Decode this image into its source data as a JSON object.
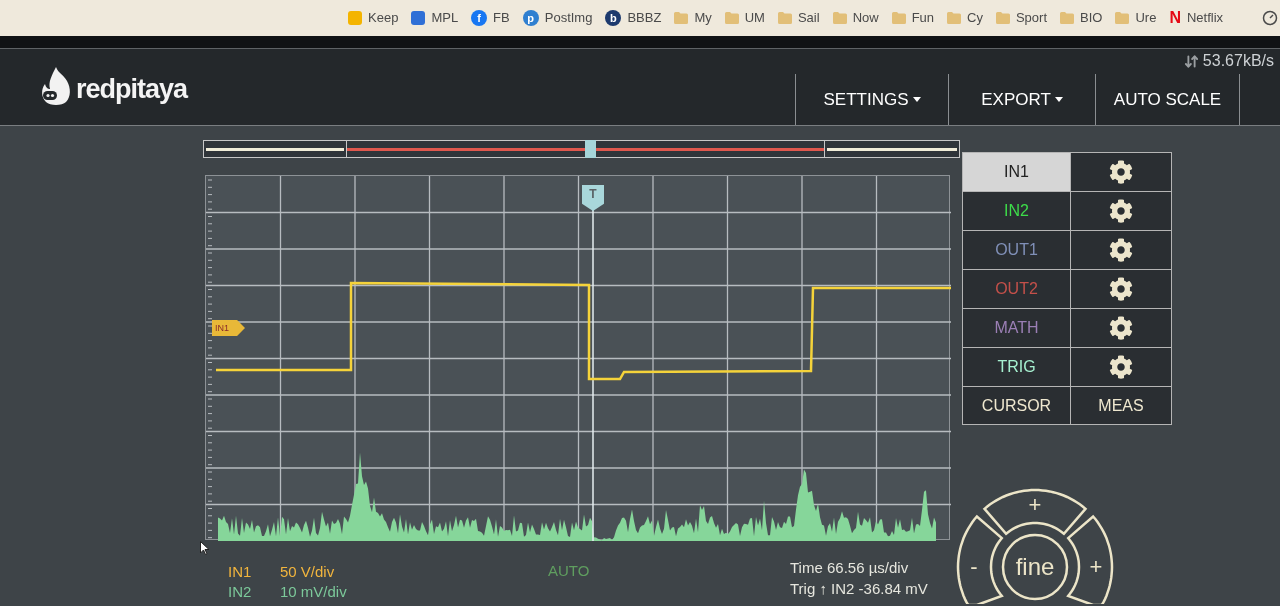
{
  "bookmarks": [
    {
      "label": "Keep",
      "kind": "tile",
      "color": "#f4b400"
    },
    {
      "label": "MPL",
      "kind": "tile",
      "color": "#2f6fd6"
    },
    {
      "label": "FB",
      "kind": "badge",
      "glyph": "f",
      "color": "#1877f2"
    },
    {
      "label": "PostImg",
      "kind": "badge",
      "glyph": "p",
      "color": "#2f7fd0"
    },
    {
      "label": "BBBZ",
      "kind": "badge",
      "glyph": "b",
      "color": "#1d3a6e"
    },
    {
      "label": "My",
      "kind": "folder"
    },
    {
      "label": "UM",
      "kind": "folder"
    },
    {
      "label": "Sail",
      "kind": "folder"
    },
    {
      "label": "Now",
      "kind": "folder"
    },
    {
      "label": "Fun",
      "kind": "folder"
    },
    {
      "label": "Cy",
      "kind": "folder"
    },
    {
      "label": "Sport",
      "kind": "folder"
    },
    {
      "label": "BIO",
      "kind": "folder"
    },
    {
      "label": "Ure",
      "kind": "folder"
    },
    {
      "label": "Netflix",
      "kind": "letter",
      "glyph": "N",
      "color": "#e50914"
    }
  ],
  "header": {
    "logo": "redpitaya",
    "speed": "53.67kB/s",
    "menu": [
      {
        "label": "SETTINGS",
        "dropdown": true
      },
      {
        "label": "EXPORT",
        "dropdown": true
      },
      {
        "label": "AUTO SCALE",
        "dropdown": false
      }
    ]
  },
  "plot": {
    "trigger_marker": "T",
    "channel_marker": "IN1"
  },
  "rows": [
    {
      "label": "IN1",
      "selected": true
    },
    {
      "label": "IN2",
      "selected": false,
      "color": "#3ddc4a"
    },
    {
      "label": "OUT1",
      "selected": false,
      "color": "#8090b8"
    },
    {
      "label": "OUT2",
      "selected": false,
      "color": "#c4504a"
    },
    {
      "label": "MATH",
      "selected": false,
      "color": "#9b7fb5"
    },
    {
      "label": "TRIG",
      "selected": false,
      "color": "#a6f0d0"
    }
  ],
  "tools": [
    {
      "label": "CURSOR"
    },
    {
      "label": "MEAS"
    }
  ],
  "readouts": {
    "channels": [
      {
        "name": "IN1",
        "scale": "50 V/div",
        "color": "#f2b53d"
      },
      {
        "name": "IN2",
        "scale": "10 mV/div",
        "color": "#7cc99a"
      }
    ],
    "trigger_mode": "AUTO",
    "time": "Time 66.56 µs/div",
    "trigger": "Trig ↑ IN2 -36.84 mV"
  },
  "fine_wheel": {
    "center": "fine",
    "up": "+",
    "left": "-",
    "right": "+"
  }
}
